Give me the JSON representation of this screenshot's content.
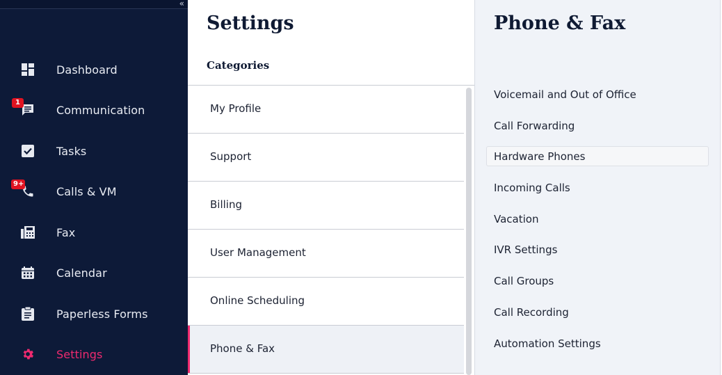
{
  "sidebar": {
    "collapse_glyph": "«",
    "items": [
      {
        "label": "Dashboard",
        "icon": "dashboard-icon"
      },
      {
        "label": "Communication",
        "icon": "chat-icon",
        "badge": "1"
      },
      {
        "label": "Tasks",
        "icon": "checkbox-icon"
      },
      {
        "label": "Calls & VM",
        "icon": "phone-icon",
        "badge": "9+"
      },
      {
        "label": "Fax",
        "icon": "fax-icon"
      },
      {
        "label": "Calendar",
        "icon": "calendar-icon"
      },
      {
        "label": "Paperless Forms",
        "icon": "clipboard-icon"
      },
      {
        "label": "Settings",
        "icon": "gear-icon",
        "active": true
      }
    ]
  },
  "settings": {
    "title": "Settings",
    "subtitle": "Categories",
    "categories": [
      {
        "label": "My Profile"
      },
      {
        "label": "Support"
      },
      {
        "label": "Billing"
      },
      {
        "label": "User Management"
      },
      {
        "label": "Online Scheduling"
      },
      {
        "label": "Phone & Fax",
        "active": true
      }
    ]
  },
  "phone_fax": {
    "title": "Phone & Fax",
    "options": [
      {
        "label": "Voicemail and Out of Office"
      },
      {
        "label": "Call Forwarding"
      },
      {
        "label": "Hardware Phones",
        "hovered": true
      },
      {
        "label": "Incoming Calls"
      },
      {
        "label": "Vacation"
      },
      {
        "label": "IVR Settings"
      },
      {
        "label": "Call Groups"
      },
      {
        "label": "Call Recording"
      },
      {
        "label": "Automation Settings"
      }
    ]
  },
  "colors": {
    "sidebar_bg": "#0d1a38",
    "accent": "#ee2a6f",
    "badge": "#e01321"
  }
}
